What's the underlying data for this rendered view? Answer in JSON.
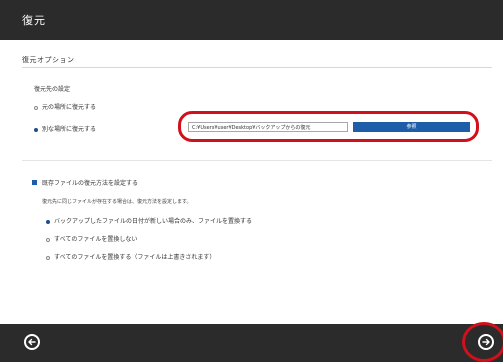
{
  "window": {
    "title": "復元"
  },
  "options": {
    "section_title": "復元オプション",
    "destination_label": "復元先の設定",
    "radio_original": "元の場所に復元する",
    "radio_other": "別な場所に復元する",
    "path_value": "C:¥Users¥user¥Desktop¥バックアップからの復元",
    "browse_label": "参照",
    "checkbox_label": "既存ファイルの復元方法を設定する",
    "description": "復元先に同じファイルが存在する場合は、復元方法を設定します。",
    "choice_1": "バックアップしたファイルの日付が新しい場合のみ、ファイルを置換する",
    "choice_2": "すべてのファイルを置換しない",
    "choice_3": "すべてのファイルを置換する（ファイルは上書きされます）"
  },
  "footer": {
    "back_icon": "arrow-left-circle-icon",
    "next_icon": "arrow-right-circle-icon"
  },
  "colors": {
    "titlebar": "#2b2b2b",
    "accent": "#1e5ea8",
    "highlight": "#d0101a"
  }
}
